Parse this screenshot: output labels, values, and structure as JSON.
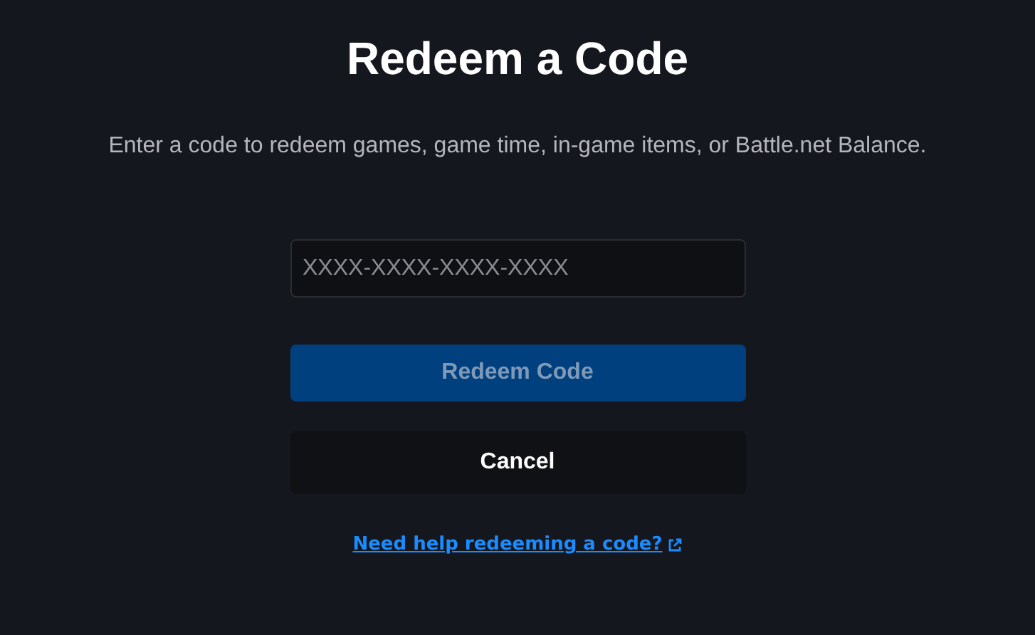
{
  "title": "Redeem a Code",
  "subtitle": "Enter a code to redeem games, game time, in-game items, or Battle.net Balance.",
  "code_field": {
    "placeholder": "XXXX-XXXX-XXXX-XXXX"
  },
  "redeem_button": {
    "label": "Redeem Code",
    "disabled": true
  },
  "cancel_button": {
    "label": "Cancel"
  },
  "help_link": {
    "label": "Need help redeeming a code?"
  }
}
